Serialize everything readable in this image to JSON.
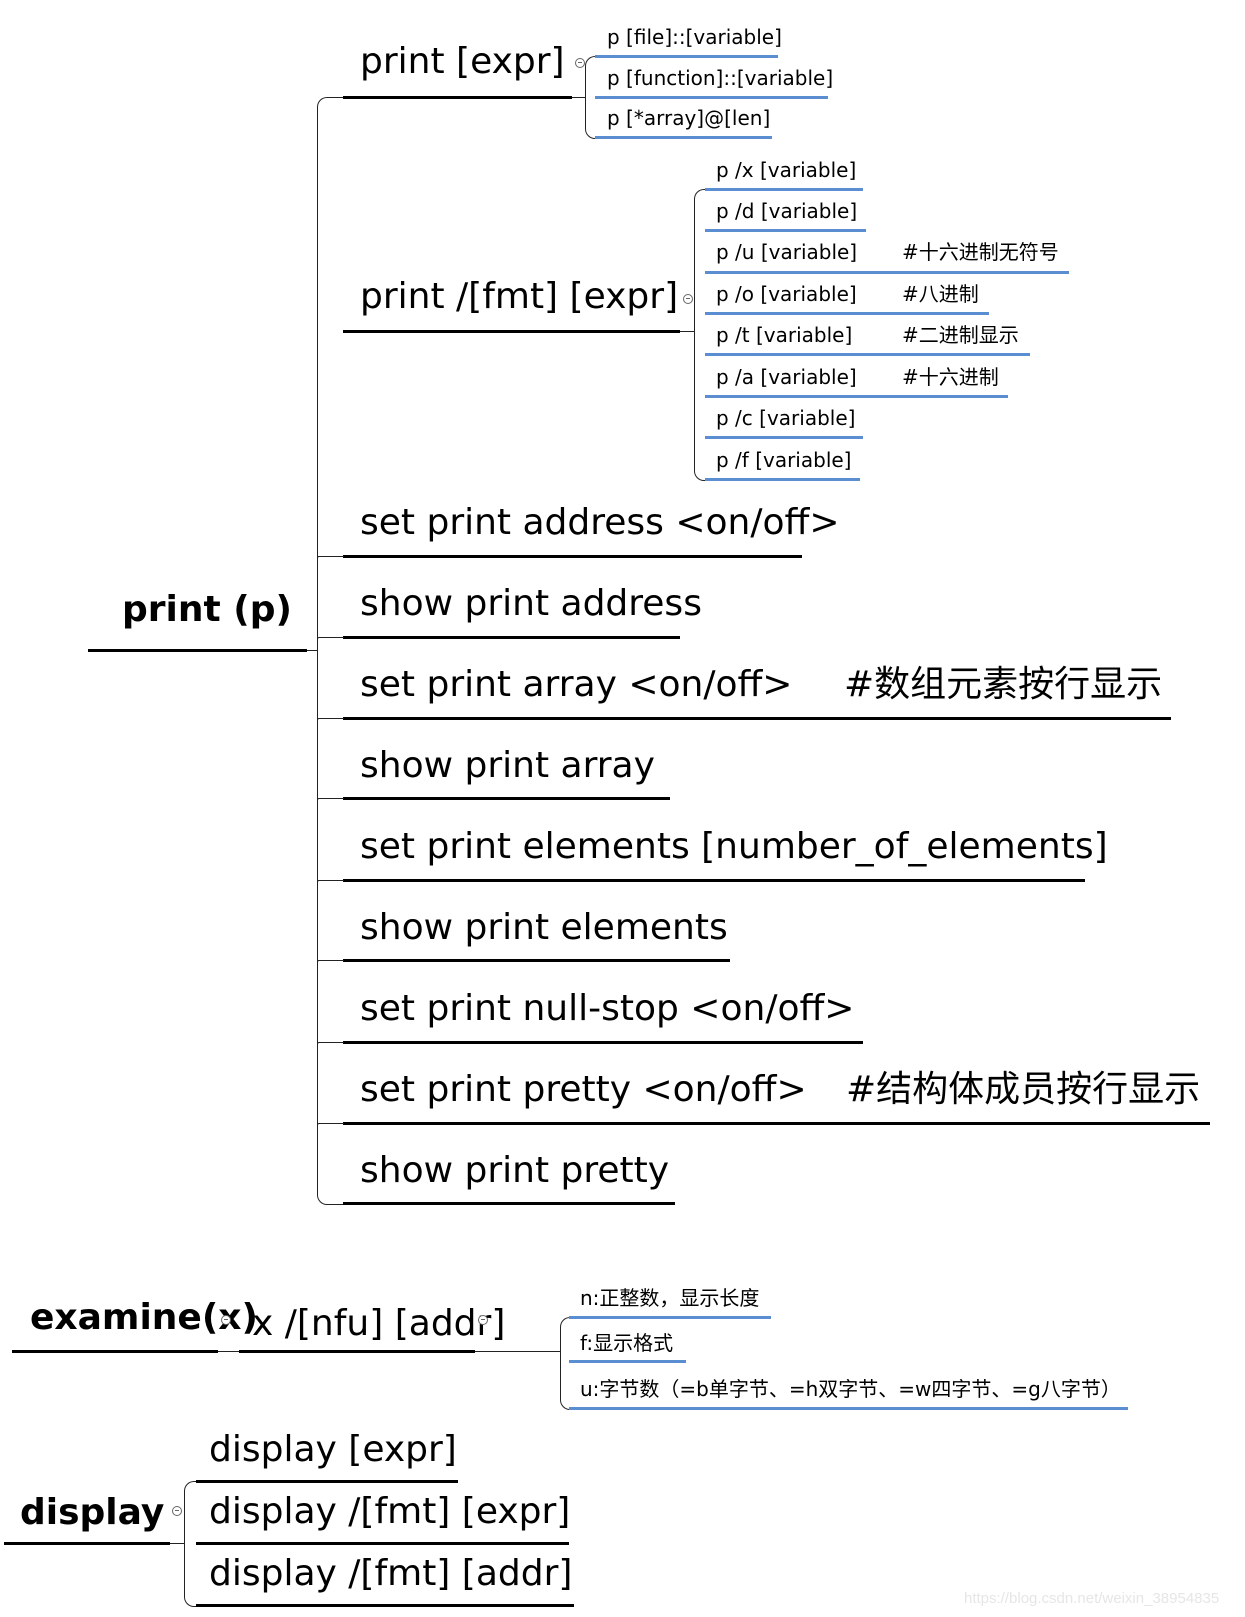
{
  "print": {
    "root_label": "print (p)",
    "children": [
      {
        "label": "print [expr]",
        "children": [
          {
            "label": "p [file]::[variable]"
          },
          {
            "label": "p [function]::[variable]"
          },
          {
            "label": "p [*array]@[len]"
          }
        ]
      },
      {
        "label": "print /[fmt] [expr]",
        "children": [
          {
            "label": "p /x [variable]",
            "comment": ""
          },
          {
            "label": "p /d [variable]",
            "comment": ""
          },
          {
            "label": "p /u [variable]",
            "comment": "#十六进制无符号"
          },
          {
            "label": "p /o [variable]",
            "comment": "#八进制"
          },
          {
            "label": "p /t [variable]",
            "comment": "#二进制显示"
          },
          {
            "label": "p /a [variable]",
            "comment": "#十六进制"
          },
          {
            "label": "p /c [variable]",
            "comment": ""
          },
          {
            "label": "p /f [variable]",
            "comment": ""
          }
        ]
      },
      {
        "label": "set print address <on/off>",
        "comment": ""
      },
      {
        "label": "show print address",
        "comment": ""
      },
      {
        "label": "set print array <on/off>",
        "comment": "#数组元素按行显示"
      },
      {
        "label": "show print array",
        "comment": ""
      },
      {
        "label": "set print elements [number_of_elements]",
        "comment": ""
      },
      {
        "label": "show print elements",
        "comment": ""
      },
      {
        "label": "set print null-stop <on/off>",
        "comment": ""
      },
      {
        "label": "set print pretty <on/off>",
        "comment": "#结构体成员按行显示"
      },
      {
        "label": "show print pretty",
        "comment": ""
      }
    ]
  },
  "examine": {
    "root_label": "examine(x)",
    "child": {
      "label": "x /[nfu] [addr]",
      "children": [
        {
          "label": "n:正整数，显示长度"
        },
        {
          "label": "f:显示格式"
        },
        {
          "label": "u:字节数（=b单字节、=h双字节、=w四字节、=g八字节）"
        }
      ]
    }
  },
  "display": {
    "root_label": "display",
    "children": [
      {
        "label": "display [expr]"
      },
      {
        "label": "display /[fmt] [expr]"
      },
      {
        "label": "display /[fmt] [addr]"
      }
    ]
  },
  "watermark": "https://blog.csdn.net/weixin_38954835",
  "colors": {
    "line": "#000000",
    "leaf_underline": "#5b8ed1"
  }
}
